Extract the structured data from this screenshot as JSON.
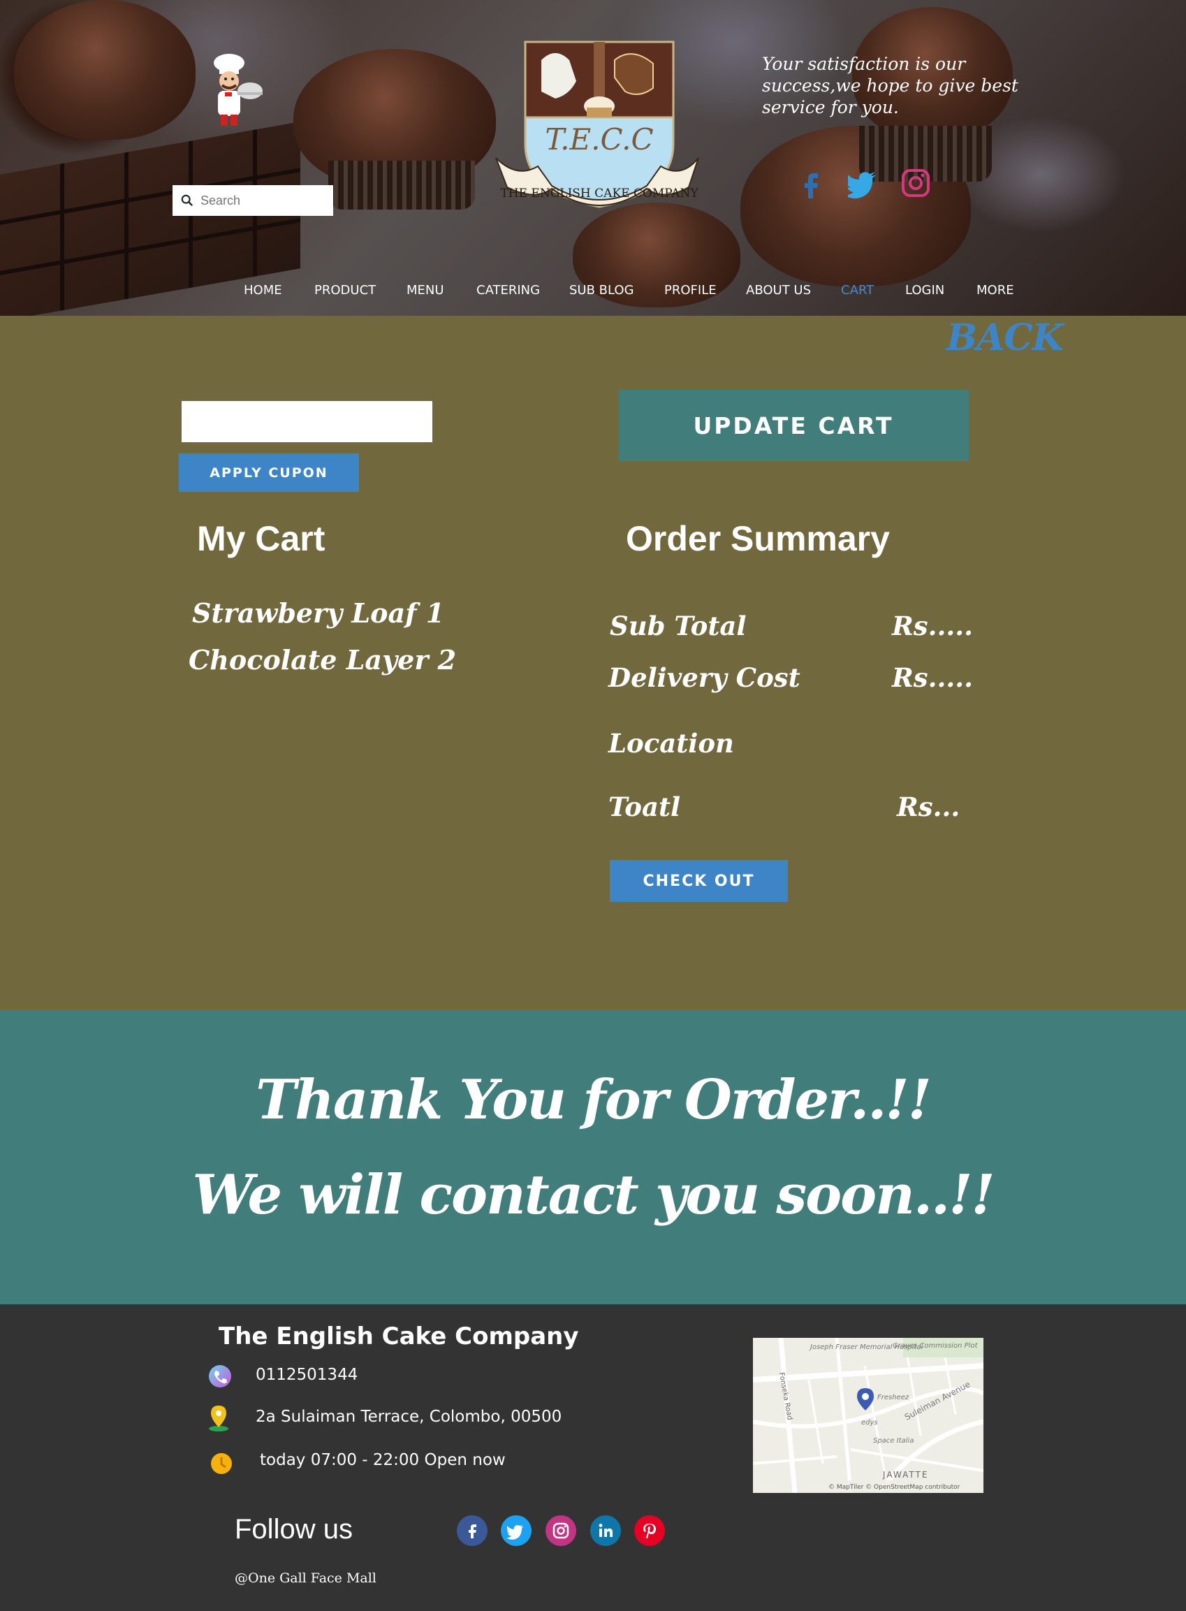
{
  "header": {
    "search_placeholder": "Search",
    "tagline": "Your satisfaction is our success,we hope to give best service for you.",
    "logo_text": "T.E.C.C",
    "logo_ribbon": "THE ENGLISH CAKE COMPANY",
    "social_icons": [
      "facebook-icon",
      "twitter-icon",
      "instagram-icon"
    ],
    "nav": [
      {
        "label": "HOME",
        "active": false
      },
      {
        "label": "PRODUCT",
        "active": false
      },
      {
        "label": "MENU",
        "active": false
      },
      {
        "label": "CATERING",
        "active": false
      },
      {
        "label": "SUB BLOG",
        "active": false
      },
      {
        "label": "PROFILE",
        "active": false
      },
      {
        "label": "ABOUT US",
        "active": false
      },
      {
        "label": "CART",
        "active": true
      },
      {
        "label": "LOGIN",
        "active": false
      },
      {
        "label": "MORE",
        "active": false
      }
    ]
  },
  "cart": {
    "back_label": "BACK",
    "coupon_value": "",
    "apply_label": "APPLY CUPON",
    "update_label": "UPDATE CART",
    "my_cart_title": "My Cart",
    "items": [
      "Strawbery  Loaf  1",
      "Chocolate Layer  2"
    ],
    "summary_title": "Order  Summary",
    "summary": {
      "subtotal_label": "Sub Total",
      "subtotal_value": "Rs.....",
      "delivery_label": "Delivery Cost",
      "delivery_value": "Rs.....",
      "location_label": "Location",
      "total_label": "Toatl",
      "total_value": "Rs..."
    },
    "checkout_label": "CHECK OUT"
  },
  "thanks": {
    "line1": "Thank You for Order..!!",
    "line2": "We will contact you soon..!!"
  },
  "footer": {
    "company": "The English Cake Company",
    "phone": "0112501344",
    "address": "2a Sulaiman Terrace, Colombo, 00500",
    "hours": "today 07:00 - 22:00 Open now",
    "follow_label": "Follow us",
    "social_icons": [
      "facebook-icon",
      "twitter-icon",
      "instagram-icon",
      "linkedin-icon",
      "pinterest-icon"
    ],
    "mall": "@One Gall Face Mall",
    "map_labels": {
      "hospital": "Joseph Fraser Memorial Hospital",
      "plot": "Graves Commission Plot",
      "road": "Fonseka Road",
      "avenue": "Suleiman Avenue",
      "shop1": "Fresheez",
      "shop2": "edys",
      "shop3": "Space Italia",
      "area": "JAWATTE",
      "credit": "© MapTiler © OpenStreetMap contributor"
    }
  },
  "colors": {
    "main_bg": "#72683e",
    "teal": "#417d7b",
    "blue": "#3d85c6",
    "footer_bg": "#333333"
  }
}
